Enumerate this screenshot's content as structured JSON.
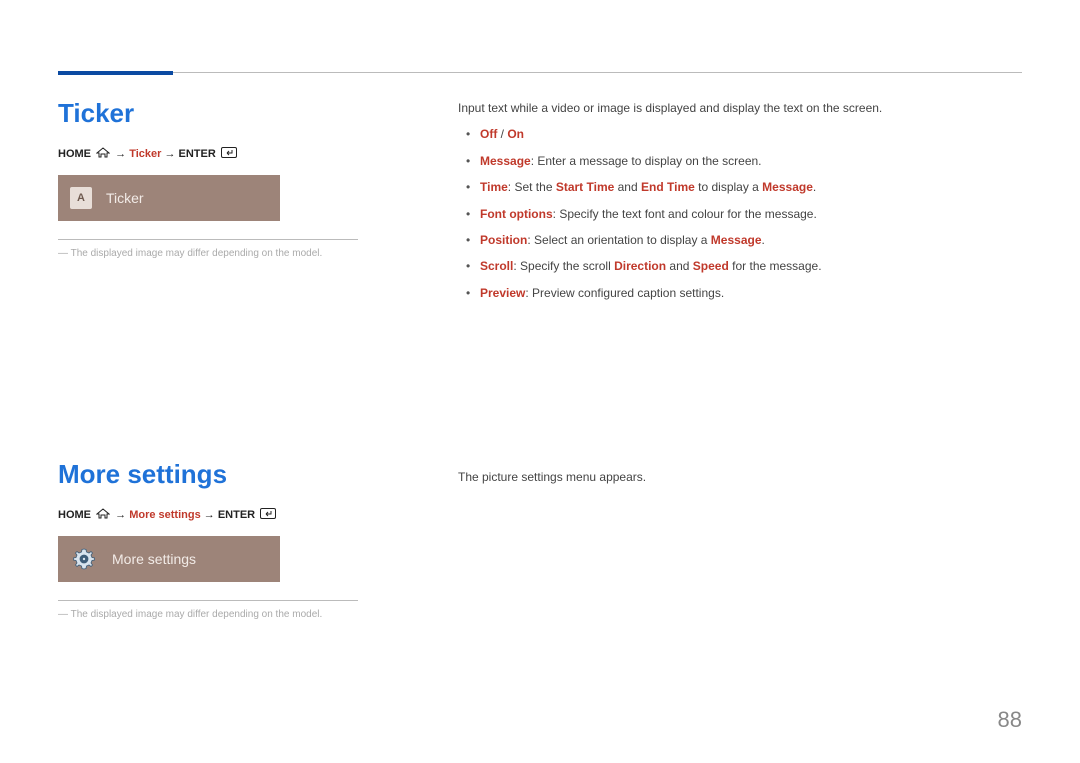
{
  "page_number": "88",
  "sections": {
    "ticker": {
      "title": "Ticker",
      "breadcrumb": {
        "home": "HOME",
        "mid": "Ticker",
        "enter": "ENTER",
        "arrow": "→"
      },
      "tile": {
        "letter": "A",
        "label": "Ticker"
      },
      "note": "The displayed image may differ depending on the model.",
      "intro": "Input text while a video or image is displayed and display the text on the screen.",
      "bullets": {
        "offon": {
          "off": "Off",
          "slash": " / ",
          "on": "On"
        },
        "message": {
          "k": "Message",
          "t": ": Enter a message to display on the screen."
        },
        "time": {
          "k": "Time",
          "pre": ": Set the ",
          "st": "Start Time",
          "mid": " and ",
          "et": "End Time",
          "post": " to display a ",
          "msg": "Message",
          "dot": "."
        },
        "font": {
          "k": "Font options",
          "t": ": Specify the text font and colour for the message."
        },
        "position": {
          "k": "Position",
          "pre": ": Select an orientation to display a ",
          "msg": "Message",
          "dot": "."
        },
        "scroll": {
          "k": "Scroll",
          "pre": ": Specify the scroll ",
          "dir": "Direction",
          "mid": " and ",
          "spd": "Speed",
          "post": " for the message."
        },
        "preview": {
          "k": "Preview",
          "t": ": Preview configured caption settings."
        }
      }
    },
    "more": {
      "title": "More settings",
      "breadcrumb": {
        "home": "HOME",
        "mid": "More settings",
        "enter": "ENTER",
        "arrow": "→"
      },
      "tile": {
        "label": "More settings"
      },
      "note": "The displayed image may differ depending on the model.",
      "body": "The picture settings menu appears."
    }
  }
}
